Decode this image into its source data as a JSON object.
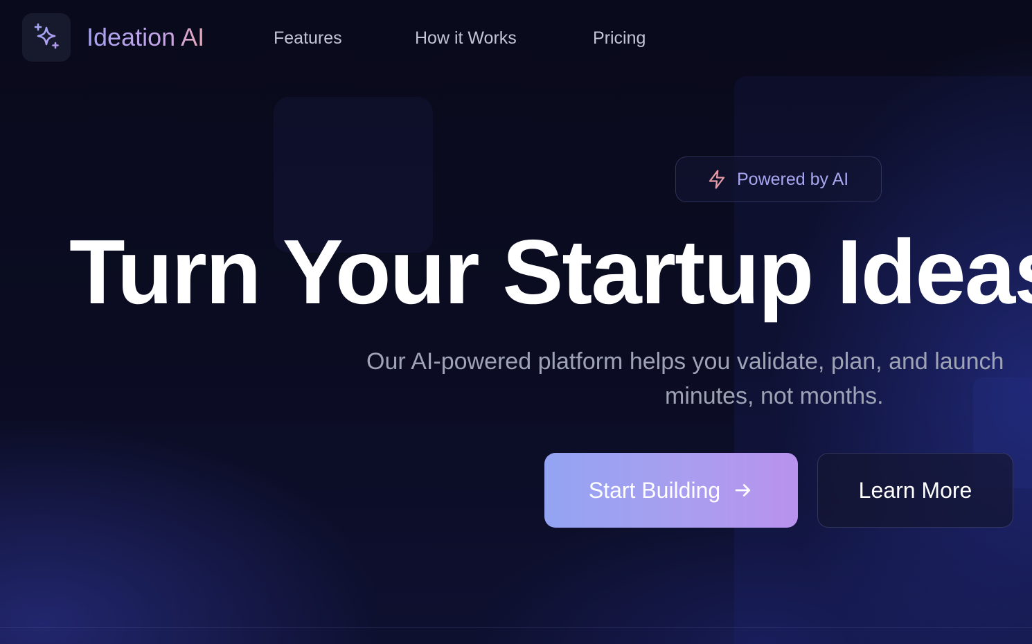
{
  "brand": {
    "name": "Ideation AI",
    "logo_icon": "sparkles-icon",
    "gradient": [
      "#a7a2f3",
      "#e9a7b4"
    ]
  },
  "nav": {
    "links": [
      {
        "label": "Features"
      },
      {
        "label": "How it Works"
      },
      {
        "label": "Pricing"
      }
    ]
  },
  "hero": {
    "badge": {
      "icon": "lightning-bolt-icon",
      "label": "Powered by AI"
    },
    "headline": "Turn Your Startup Ideas",
    "subheadline_line1": "Our AI-powered platform helps you validate, plan, and launch",
    "subheadline_line2": "minutes, not months.",
    "primary_cta": {
      "label": "Start Building",
      "icon": "arrow-right-icon"
    },
    "secondary_cta": {
      "label": "Learn More"
    }
  },
  "colors": {
    "background": "#0a0b1e",
    "accent_start": "#93a4f2",
    "accent_end": "#b992ee",
    "text_muted": "#9fa3b6"
  }
}
